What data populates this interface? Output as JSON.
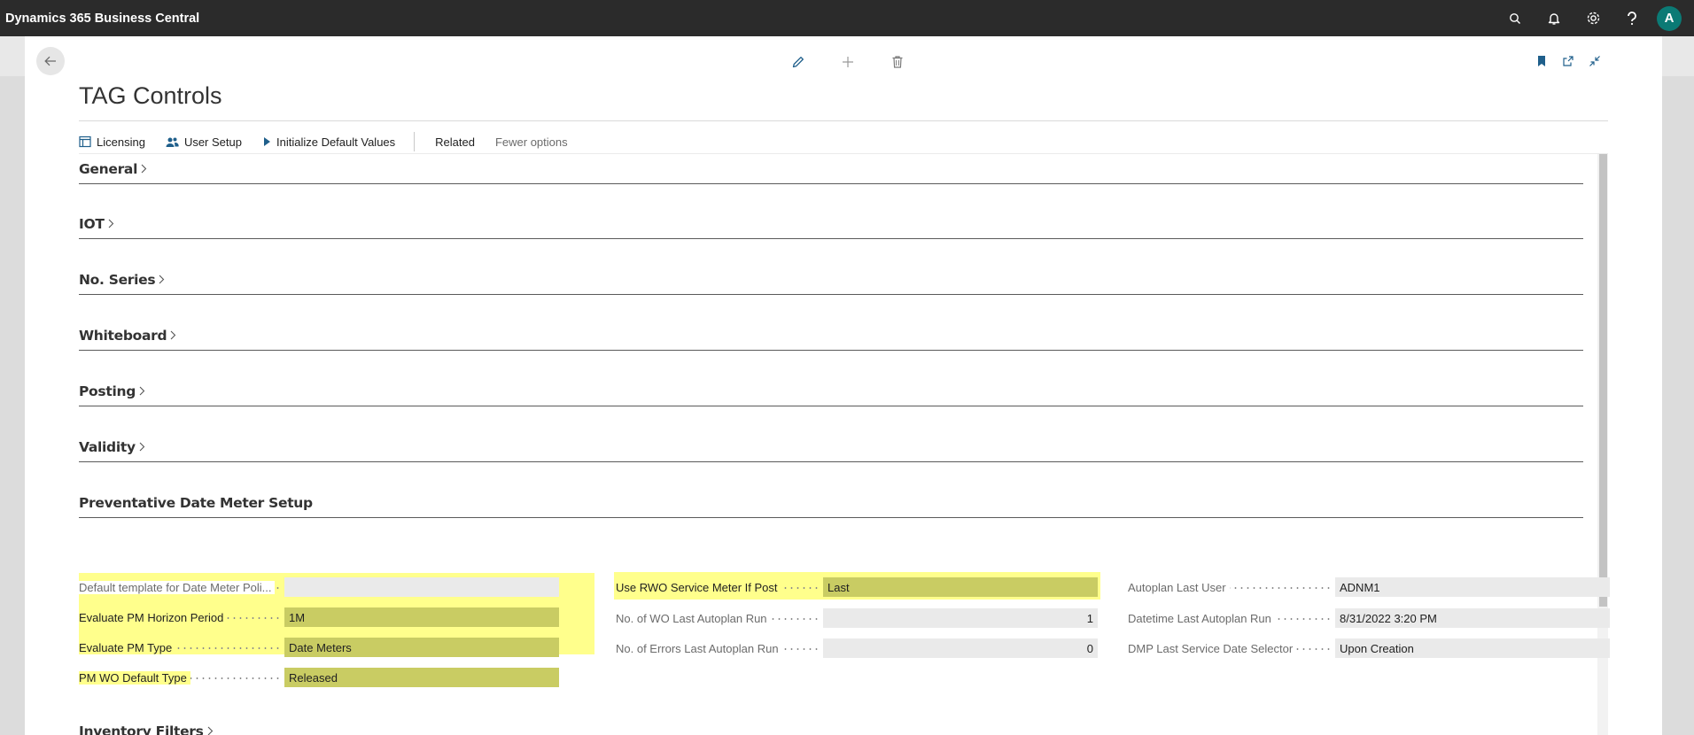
{
  "app": {
    "brand": "Dynamics 365 Business Central",
    "avatar_initial": "A"
  },
  "page": {
    "title": "TAG Controls"
  },
  "actions": {
    "licensing": "Licensing",
    "user_setup": "User Setup",
    "initialize_defaults": "Initialize Default Values",
    "related": "Related",
    "fewer_options": "Fewer options"
  },
  "sections": {
    "general": "General",
    "iot": "IOT",
    "no_series": "No. Series",
    "whiteboard": "Whiteboard",
    "posting": "Posting",
    "validity": "Validity",
    "pdm_setup": "Preventative Date Meter Setup",
    "inventory_filters": "Inventory Filters"
  },
  "pdm": {
    "col1": [
      {
        "label": "Default template for Date Meter Poli...",
        "value": ""
      },
      {
        "label": "Evaluate PM Horizon Period",
        "value": "1M"
      },
      {
        "label": "Evaluate PM Type",
        "value": "Date Meters"
      },
      {
        "label": "PM WO Default Type",
        "value": "Released"
      }
    ],
    "col2": [
      {
        "label": "Use RWO Service Meter If Post",
        "value": "Last"
      },
      {
        "label": "No. of WO Last Autoplan Run",
        "value": "1"
      },
      {
        "label": "No. of Errors Last Autoplan Run",
        "value": "0"
      }
    ],
    "col3": [
      {
        "label": "Autoplan Last User",
        "value": "ADNM1"
      },
      {
        "label": "Datetime Last Autoplan Run",
        "value": "8/31/2022 3:20 PM"
      },
      {
        "label": "DMP Last Service Date Selector",
        "value": "Upon Creation"
      }
    ]
  },
  "colors": {
    "appbar": "#2b2b2b",
    "highlight": "#ffff8c",
    "highlight_value": "#c9cc63",
    "avatar": "#0b7a75"
  }
}
